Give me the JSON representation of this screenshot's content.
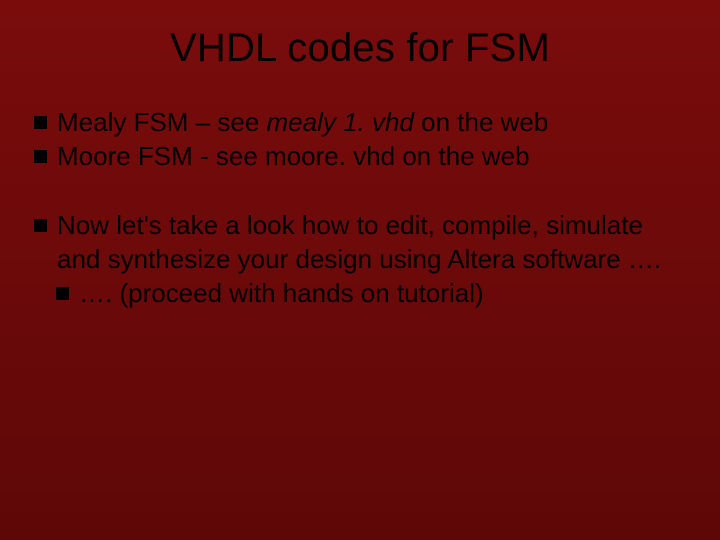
{
  "title": "VHDL codes for FSM",
  "group1": {
    "b1": {
      "pre": "Mealy FSM – see ",
      "em": "mealy 1. vhd",
      "post": "  on the web"
    },
    "b2": {
      "text": "Moore FSM -  see moore. vhd  on the web"
    }
  },
  "group2": {
    "b1": {
      "text": "Now let's take a look how to edit, compile, simulate and synthesize your design using Altera software …."
    },
    "b2": {
      "text": " …. (proceed with hands on tutorial)"
    }
  }
}
